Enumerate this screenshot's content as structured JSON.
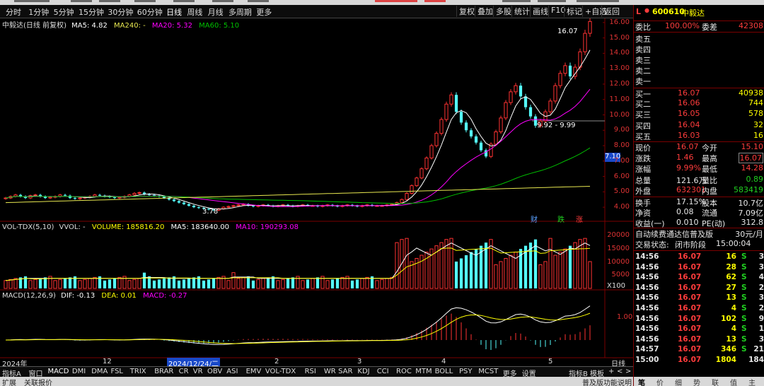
{
  "toolbar": {
    "periods": [
      "分时",
      "1分钟",
      "5分钟",
      "15分钟",
      "30分钟",
      "60分钟",
      "日线",
      "周线",
      "月线",
      "多周期",
      "更多"
    ],
    "active_period": "日线",
    "more_caret": "▾",
    "right_buttons": [
      "复权",
      "叠加",
      "多股",
      "统计",
      "画线",
      "F10",
      "标记",
      "+自选",
      "返回"
    ]
  },
  "main_chart": {
    "legend_name": "中毅达(日线 前复权)",
    "ma5": "MA5: 4.82",
    "ma240": "MA240: -",
    "ma20": "MA20: 5.32",
    "ma60": "MA60: 5.10",
    "colors": {
      "ma5": "#ffffff",
      "ma20": "#ff00ff",
      "ma60": "#00c000",
      "ma240": "#e8e850"
    },
    "high_label": "16.07",
    "low_label": "3.78",
    "range_label": "9.92 - 9.99",
    "current_price_tag": "7.10",
    "y_ticks": [
      "16.00",
      "15.00",
      "14.00",
      "13.00",
      "12.00",
      "11.00",
      "10.00",
      "9.00",
      "8.00",
      "7.00",
      "6.00",
      "5.00",
      "4.00"
    ],
    "markers": [
      {
        "text": "财",
        "color": "#5aa0ff"
      },
      {
        "text": "跌",
        "color": "#20d020"
      },
      {
        "text": "涨",
        "color": "#ff3c3c"
      }
    ]
  },
  "chart_data": {
    "type": "candlestick",
    "title": "中毅达(日线 前复权)",
    "ylim": [
      3.5,
      16.5
    ],
    "high": 16.07,
    "low": 3.78,
    "ohlc_close_approx": [
      4.6,
      4.7,
      4.8,
      4.7,
      4.6,
      4.75,
      4.8,
      4.7,
      4.6,
      4.65,
      4.7,
      4.8,
      4.75,
      4.6,
      4.55,
      4.6,
      4.65,
      4.7,
      4.8,
      4.75,
      4.7,
      4.65,
      4.6,
      4.65,
      4.7,
      4.8,
      4.9,
      4.95,
      4.85,
      4.8,
      4.75,
      4.7,
      4.6,
      4.5,
      4.4,
      4.3,
      4.2,
      4.1,
      4.0,
      3.95,
      3.9,
      3.85,
      3.8,
      3.9,
      4.0,
      4.05,
      4.1,
      4.15,
      4.2,
      4.1,
      4.05,
      4.1,
      4.15,
      4.1,
      4.05,
      4.1,
      4.15,
      4.1,
      4.05,
      4.1,
      4.15,
      4.1,
      4.1,
      4.05,
      4.1,
      4.15,
      4.1,
      4.05,
      4.1,
      4.15,
      4.1,
      4.05,
      4.1,
      4.15,
      4.1,
      4.1,
      4.1,
      4.15,
      4.2,
      4.3,
      4.5,
      4.9,
      5.4,
      5.9,
      6.5,
      7.2,
      8.0,
      8.8,
      9.7,
      10.7,
      11.3,
      10.2,
      9.5,
      9.0,
      8.6,
      8.2,
      7.7,
      7.3,
      8.1,
      8.9,
      9.8,
      10.8,
      11.5,
      11.9,
      11.2,
      10.5,
      9.9,
      9.3,
      9.6,
      10.2,
      10.9,
      11.9,
      12.7,
      13.2,
      12.5,
      13.1,
      14.1,
      15.3,
      16.07
    ],
    "volume": {
      "VOLUME": "185816.20",
      "MA5": "183640.00",
      "MA10": "190293.08",
      "ylim": [
        0,
        22000
      ],
      "unit": "X100"
    },
    "macd": {
      "DIF": "-0.13",
      "DEA": "0.01",
      "MACD": "-0.27"
    }
  },
  "volume_chart": {
    "legend_name": "VOL-TDX(5,10)",
    "vvol": "VVOL: -",
    "volume": "VOLUME: 185816.20",
    "ma5": "MA5: 183640.00",
    "ma10": "MA10: 190293.08",
    "y_ticks": [
      "20000",
      "15000",
      "10000",
      "5000"
    ],
    "unit": "X100"
  },
  "macd_chart": {
    "legend_name": "MACD(12,26,9)",
    "dif": "DIF: -0.13",
    "dea": "DEA: 0.01",
    "macd": "MACD: -0.27",
    "y_tick": "1.00"
  },
  "x_axis": {
    "labels": [
      "2024年",
      "12",
      "2024/12/24/二",
      "2",
      "3",
      "4",
      "5"
    ],
    "period_label": "日线"
  },
  "indicator_tabs": [
    "指标A",
    "窗口",
    "MACD",
    "DMI",
    "DMA",
    "FSL",
    "TRIX",
    "BRAR",
    "CR",
    "VR",
    "OBV",
    "ASI",
    "EMV",
    "VOL-TDX",
    "RSI",
    "WR",
    "SAR",
    "KDJ",
    "CCI",
    "ROC",
    "MTM",
    "BOLL",
    "PSY",
    "MCST",
    "更多",
    "设置"
  ],
  "indicator_tabs_right": [
    "指标B",
    "模板",
    "+",
    "<",
    ">"
  ],
  "panel": {
    "flag": "L",
    "code": "600610",
    "name": "中毅达",
    "weibi_label": "委比",
    "weibi_value": "100.00%",
    "weicha_label": "委差",
    "weicha_value": "42308",
    "sell_levels": [
      "卖五",
      "卖四",
      "卖三",
      "卖二",
      "卖一"
    ],
    "buy_levels": [
      {
        "label": "买一",
        "price": "16.07",
        "vol": "40938"
      },
      {
        "label": "买二",
        "price": "16.06",
        "vol": "744"
      },
      {
        "label": "买三",
        "price": "16.05",
        "vol": "578"
      },
      {
        "label": "买四",
        "price": "16.04",
        "vol": "32"
      },
      {
        "label": "买五",
        "price": "16.03",
        "vol": "16"
      }
    ],
    "stats": [
      {
        "l1": "现价",
        "v1": "16.07",
        "c1": "red",
        "l2": "今开",
        "v2": "15.10",
        "c2": "red"
      },
      {
        "l1": "涨跌",
        "v1": "1.46",
        "c1": "red",
        "l2": "最高",
        "v2": "16.07",
        "c2": "red"
      },
      {
        "l1": "涨幅",
        "v1": "9.99%",
        "c1": "red",
        "l2": "最低",
        "v2": "14.28",
        "c2": "red"
      },
      {
        "l1": "总量",
        "v1": "121.6万",
        "c1": "white",
        "l2": "量比",
        "v2": "0.89",
        "c2": "green"
      },
      {
        "l1": "外盘",
        "v1": "632301",
        "c1": "red",
        "l2": "内盘",
        "v2": "583419",
        "c2": "green"
      }
    ],
    "stats2": [
      {
        "l1": "换手",
        "v1": "17.15%",
        "l2": "股本",
        "v2": "10.7亿"
      },
      {
        "l1": "净资",
        "v1": "0.08",
        "l2": "流通",
        "v2": "7.09亿"
      },
      {
        "l1": "收益(一)",
        "v1": "0.010",
        "l2": "PE(动)",
        "v2": "312.8"
      }
    ],
    "promo": "自动续费通达信普及版",
    "promo_price": "30元/月",
    "trade_status_label": "交易状态:",
    "trade_status": "闭市阶段",
    "trade_time": "15:00:04",
    "ticks": [
      {
        "t": "14:56",
        "p": "16.07",
        "v": "16",
        "s": "S",
        "n": "3"
      },
      {
        "t": "14:56",
        "p": "16.07",
        "v": "28",
        "s": "S",
        "n": "3"
      },
      {
        "t": "14:56",
        "p": "16.07",
        "v": "62",
        "s": "S",
        "n": "4"
      },
      {
        "t": "14:56",
        "p": "16.07",
        "v": "27",
        "s": "S",
        "n": "2"
      },
      {
        "t": "14:56",
        "p": "16.07",
        "v": "13",
        "s": "S",
        "n": "3"
      },
      {
        "t": "14:56",
        "p": "16.07",
        "v": "4",
        "s": "S",
        "n": "2"
      },
      {
        "t": "14:56",
        "p": "16.07",
        "v": "102",
        "s": "S",
        "n": "9"
      },
      {
        "t": "14:56",
        "p": "16.07",
        "v": "4",
        "s": "S",
        "n": "1"
      },
      {
        "t": "14:56",
        "p": "16.07",
        "v": "13",
        "s": "S",
        "n": "3"
      },
      {
        "t": "14:57",
        "p": "16.07",
        "v": "346",
        "s": "S",
        "n": "21"
      },
      {
        "t": "15:00",
        "p": "16.07",
        "v": "1804",
        "s": "",
        "n": "184"
      }
    ],
    "bottom_tabs": [
      "笔",
      "价",
      "细",
      "势",
      "联",
      "值",
      "主"
    ]
  },
  "statusbar": {
    "left": "扩展",
    "left2": "关联报价",
    "right": "普及版功能说明"
  }
}
